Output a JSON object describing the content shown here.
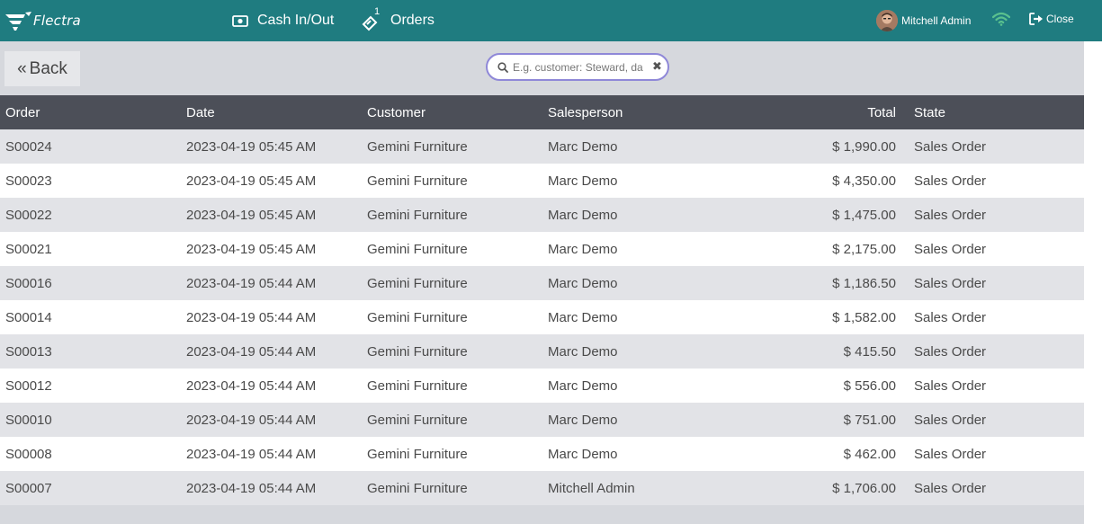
{
  "header": {
    "logo_text": "Flectra",
    "cash_label": "Cash In/Out",
    "orders_label": "Orders",
    "orders_badge": "1",
    "user_name": "Mitchell Admin",
    "close_label": "Close"
  },
  "controls": {
    "back_label": "Back",
    "search_placeholder": "E.g. customer: Steward, da"
  },
  "table": {
    "headers": {
      "order": "Order",
      "date": "Date",
      "customer": "Customer",
      "salesperson": "Salesperson",
      "total": "Total",
      "state": "State"
    },
    "rows": [
      {
        "order": "S00024",
        "date": "2023-04-19 05:45 AM",
        "customer": "Gemini Furniture",
        "salesperson": "Marc Demo",
        "total": "$ 1,990.00",
        "state": "Sales Order"
      },
      {
        "order": "S00023",
        "date": "2023-04-19 05:45 AM",
        "customer": "Gemini Furniture",
        "salesperson": "Marc Demo",
        "total": "$ 4,350.00",
        "state": "Sales Order"
      },
      {
        "order": "S00022",
        "date": "2023-04-19 05:45 AM",
        "customer": "Gemini Furniture",
        "salesperson": "Marc Demo",
        "total": "$ 1,475.00",
        "state": "Sales Order"
      },
      {
        "order": "S00021",
        "date": "2023-04-19 05:45 AM",
        "customer": "Gemini Furniture",
        "salesperson": "Marc Demo",
        "total": "$ 2,175.00",
        "state": "Sales Order"
      },
      {
        "order": "S00016",
        "date": "2023-04-19 05:44 AM",
        "customer": "Gemini Furniture",
        "salesperson": "Marc Demo",
        "total": "$ 1,186.50",
        "state": "Sales Order"
      },
      {
        "order": "S00014",
        "date": "2023-04-19 05:44 AM",
        "customer": "Gemini Furniture",
        "salesperson": "Marc Demo",
        "total": "$ 1,582.00",
        "state": "Sales Order"
      },
      {
        "order": "S00013",
        "date": "2023-04-19 05:44 AM",
        "customer": "Gemini Furniture",
        "salesperson": "Marc Demo",
        "total": "$ 415.50",
        "state": "Sales Order"
      },
      {
        "order": "S00012",
        "date": "2023-04-19 05:44 AM",
        "customer": "Gemini Furniture",
        "salesperson": "Marc Demo",
        "total": "$ 556.00",
        "state": "Sales Order"
      },
      {
        "order": "S00010",
        "date": "2023-04-19 05:44 AM",
        "customer": "Gemini Furniture",
        "salesperson": "Marc Demo",
        "total": "$ 751.00",
        "state": "Sales Order"
      },
      {
        "order": "S00008",
        "date": "2023-04-19 05:44 AM",
        "customer": "Gemini Furniture",
        "salesperson": "Marc Demo",
        "total": "$ 462.00",
        "state": "Sales Order"
      },
      {
        "order": "S00007",
        "date": "2023-04-19 05:44 AM",
        "customer": "Gemini Furniture",
        "salesperson": "Mitchell Admin",
        "total": "$ 1,706.00",
        "state": "Sales Order"
      }
    ]
  },
  "icons": {
    "logo": "flectra-logo-icon",
    "cash": "money-bill-icon",
    "orders": "tickets-icon",
    "wifi": "wifi-icon",
    "close": "sign-out-icon",
    "search": "search-icon",
    "clear": "times-icon",
    "back": "double-chevron-left-icon"
  },
  "colors": {
    "topbar": "#1f7c80",
    "wifi": "#5ac18e",
    "search_border": "#8f88d8",
    "table_header": "#4c4f58"
  }
}
